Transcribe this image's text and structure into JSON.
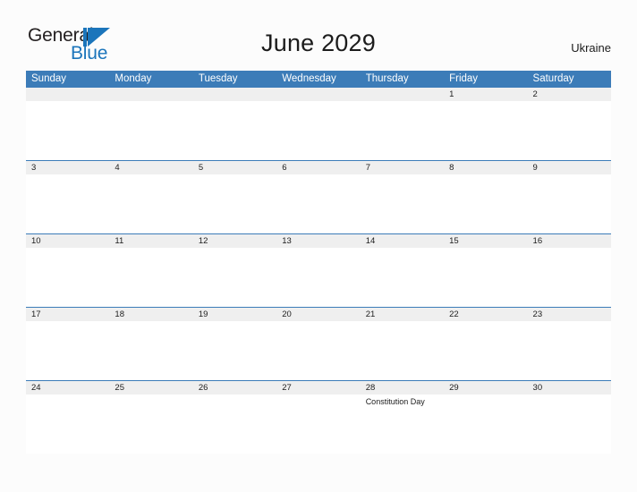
{
  "brand": {
    "name_part1": "General",
    "name_part2": "Blue",
    "mark": "triangle-logo-icon"
  },
  "header": {
    "title": "June 2029",
    "region": "Ukraine"
  },
  "calendar": {
    "month": "June",
    "year": "2029",
    "weekday_headers": [
      "Sunday",
      "Monday",
      "Tuesday",
      "Wednesday",
      "Thursday",
      "Friday",
      "Saturday"
    ],
    "colors": {
      "header_blue": "#3c7cb8",
      "daynum_band": "#efefef",
      "page_background": "#fcfcfc",
      "brand_blue": "#1b75bb",
      "text": "#1c1c1c"
    },
    "weeks": [
      [
        {
          "day": "",
          "events": []
        },
        {
          "day": "",
          "events": []
        },
        {
          "day": "",
          "events": []
        },
        {
          "day": "",
          "events": []
        },
        {
          "day": "",
          "events": []
        },
        {
          "day": "1",
          "events": []
        },
        {
          "day": "2",
          "events": []
        }
      ],
      [
        {
          "day": "3",
          "events": []
        },
        {
          "day": "4",
          "events": []
        },
        {
          "day": "5",
          "events": []
        },
        {
          "day": "6",
          "events": []
        },
        {
          "day": "7",
          "events": []
        },
        {
          "day": "8",
          "events": []
        },
        {
          "day": "9",
          "events": []
        }
      ],
      [
        {
          "day": "10",
          "events": []
        },
        {
          "day": "11",
          "events": []
        },
        {
          "day": "12",
          "events": []
        },
        {
          "day": "13",
          "events": []
        },
        {
          "day": "14",
          "events": []
        },
        {
          "day": "15",
          "events": []
        },
        {
          "day": "16",
          "events": []
        }
      ],
      [
        {
          "day": "17",
          "events": []
        },
        {
          "day": "18",
          "events": []
        },
        {
          "day": "19",
          "events": []
        },
        {
          "day": "20",
          "events": []
        },
        {
          "day": "21",
          "events": []
        },
        {
          "day": "22",
          "events": []
        },
        {
          "day": "23",
          "events": []
        }
      ],
      [
        {
          "day": "24",
          "events": []
        },
        {
          "day": "25",
          "events": []
        },
        {
          "day": "26",
          "events": []
        },
        {
          "day": "27",
          "events": []
        },
        {
          "day": "28",
          "events": [
            "Constitution Day"
          ]
        },
        {
          "day": "29",
          "events": []
        },
        {
          "day": "30",
          "events": []
        }
      ]
    ]
  }
}
